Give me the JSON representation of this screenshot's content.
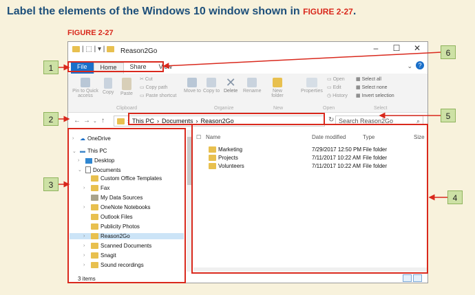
{
  "instruction": {
    "text": "Label the elements of the Windows 10 window shown in ",
    "figure_ref": "FIGURE 2-27",
    "period": "."
  },
  "figure_label": "FIGURE 2-27",
  "window": {
    "title": "Reason2Go",
    "quick_access": "| ⬚ | ▾ |",
    "controls": {
      "minimize": "–",
      "maximize": "☐",
      "close": "✕"
    },
    "tabs": {
      "file": "File",
      "home": "Home",
      "share": "Share",
      "view": "View"
    },
    "ribbon": {
      "pin": "Pin to Quick access",
      "copy": "Copy",
      "paste": "Paste",
      "cut": "Cut",
      "copy_path": "Copy path",
      "paste_shortcut": "Paste shortcut",
      "move_to": "Move to",
      "copy_to": "Copy to",
      "delete": "Delete",
      "rename": "Rename",
      "new_folder": "New folder",
      "properties": "Properties",
      "open": "Open",
      "edit": "Edit",
      "history": "History",
      "select_all": "Select all",
      "select_none": "Select none",
      "invert": "Invert selection",
      "groups": {
        "clipboard": "Clipboard",
        "organize": "Organize",
        "new": "New",
        "open": "Open",
        "select": "Select"
      }
    },
    "address": {
      "crumbs": [
        "This PC",
        "Documents",
        "Reason2Go"
      ],
      "sep": "›",
      "search_placeholder": "Search Reason2Go"
    },
    "nav_items": {
      "onedrive": "OneDrive",
      "thispc": "This PC",
      "desktop": "Desktop",
      "documents": "Documents",
      "custom_office": "Custom Office Templates",
      "fax": "Fax",
      "my_data": "My Data Sources",
      "onenote": "OneNote Notebooks",
      "outlook": "Outlook Files",
      "publicity": "Publicity Photos",
      "reason2go": "Reason2Go",
      "scanned": "Scanned Documents",
      "snagit": "Snagit",
      "sound": "Sound recordings"
    },
    "columns": {
      "name": "Name",
      "date": "Date modified",
      "type": "Type",
      "size": "Size"
    },
    "files": [
      {
        "name": "Marketing",
        "date": "7/29/2017 12:50 PM",
        "type": "File folder"
      },
      {
        "name": "Projects",
        "date": "7/11/2017 10:22 AM",
        "type": "File folder"
      },
      {
        "name": "Volunteers",
        "date": "7/11/2017 10:22 AM",
        "type": "File folder"
      }
    ],
    "status": "3 items"
  },
  "callouts": {
    "c1": "1",
    "c2": "2",
    "c3": "3",
    "c4": "4",
    "c5": "5",
    "c6": "6"
  },
  "colors": {
    "callout_fill": "#cde1a5",
    "highlight": "#d9281c",
    "accent": "#1a6fc9"
  }
}
